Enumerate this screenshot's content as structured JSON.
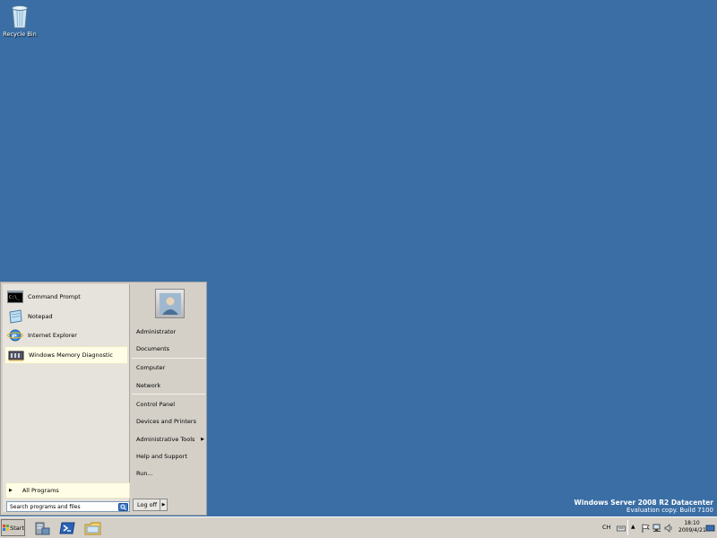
{
  "desktop": {
    "recycle_bin_label": "Recycle Bin"
  },
  "watermark": {
    "line1": "Windows Server 2008 R2 Datacenter",
    "line2": "Evaluation copy. Build 7100"
  },
  "start_menu": {
    "pinned": [
      {
        "label": "Command Prompt",
        "icon": "command-prompt-icon"
      },
      {
        "label": "Notepad",
        "icon": "notepad-icon"
      },
      {
        "label": "Internet Explorer",
        "icon": "internet-explorer-icon"
      },
      {
        "label": "Windows Memory Diagnostic",
        "icon": "memory-diagnostic-icon"
      }
    ],
    "all_programs_label": "All Programs",
    "search_placeholder": "Search programs and files",
    "right_items": {
      "administrator": "Administrator",
      "documents": "Documents",
      "computer": "Computer",
      "network": "Network",
      "control_panel": "Control Panel",
      "devices_printers": "Devices and Printers",
      "admin_tools": "Administrative Tools",
      "help_support": "Help and Support",
      "run": "Run..."
    },
    "logoff_label": "Log off"
  },
  "taskbar": {
    "start_label": "Start",
    "language": "CH",
    "time": "18:10",
    "date": "2009/4/21"
  },
  "colors": {
    "desktop": "#3a6ea5",
    "highlight": "#fffde5",
    "menu_bg": "#d4d0c8"
  }
}
